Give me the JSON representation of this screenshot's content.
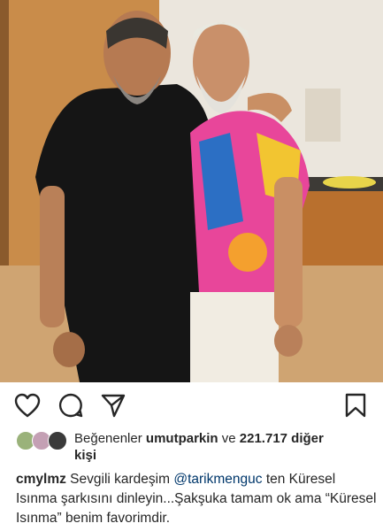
{
  "post": {
    "image_alt_icon": "photo",
    "likes": {
      "prefix": "Beğenenler",
      "user": "umutparkin",
      "joiner": "ve",
      "count": "221.717 diğer",
      "suffix": "kişi"
    },
    "caption": {
      "username": "cmylmz",
      "text_before": " Sevgili kardeşim ",
      "mention": "@tarikmenguc",
      "text_after": " ten Küresel Isınma şarkısını dinleyin...Şakşuka tamam ok ama “Küresel Isınma” benim favorimdir."
    }
  },
  "actions": {
    "like_icon": "heart-icon",
    "comment_icon": "comment-icon",
    "share_icon": "send-icon",
    "save_icon": "bookmark-icon"
  },
  "colors": {
    "text": "#262626",
    "mention": "#00376b"
  }
}
